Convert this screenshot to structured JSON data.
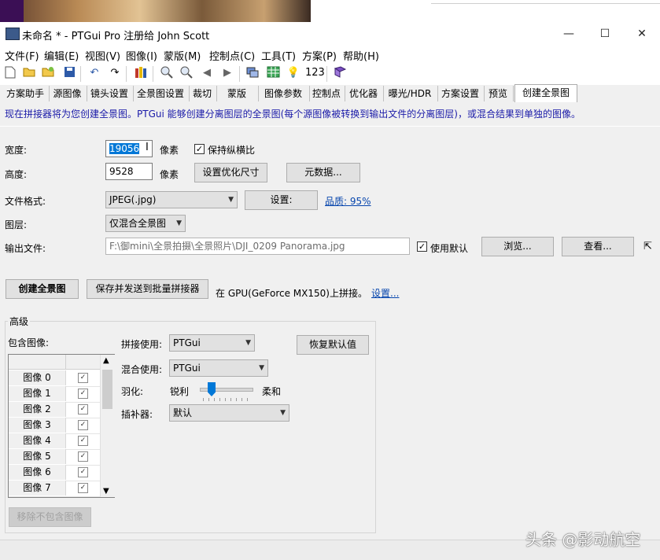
{
  "window": {
    "title": "未命名 * - PTGui Pro 注册给 John Scott",
    "minimize": "—",
    "maximize": "☐",
    "close": "✕"
  },
  "menu": [
    "文件(F)",
    "编辑(E)",
    "视图(V)",
    "图像(I)",
    "蒙版(M)",
    "控制点(C)",
    "工具(T)",
    "方案(P)",
    "帮助(H)"
  ],
  "toolbar": {
    "zoom_readout": "123"
  },
  "tabs": [
    "方案助手",
    "源图像",
    "镜头设置",
    "全景图设置",
    "裁切",
    "蒙版",
    "图像参数",
    "控制点",
    "优化器",
    "曝光/HDR",
    "方案设置",
    "预览",
    "创建全景图"
  ],
  "active_tab": "创建全景图",
  "info": "现在拼接器将为您创建全景图。PTGui 能够创建分离图层的全景图(每个源图像被转换到输出文件的分离图层)，或混合结果到单独的图像。",
  "form": {
    "width_label": "宽度:",
    "width_value": "19056",
    "pixel_unit_1": "像素",
    "keep_ratio": "保持纵横比",
    "height_label": "高度:",
    "height_value": "9528",
    "pixel_unit_2": "像素",
    "optimize_size_btn": "设置优化尺寸",
    "metadata_btn": "元数据...",
    "format_label": "文件格式:",
    "format_value": "JPEG(.jpg)",
    "settings_btn": "设置:",
    "quality_link": "品质: 95%",
    "layer_label": "图层:",
    "layer_value": "仅混合全景图",
    "output_label": "输出文件:",
    "output_value": "F:\\御mini\\全景拍摄\\全景照片\\DJI_0209 Panorama.jpg",
    "use_default": "使用默认",
    "browse_btn": "浏览...",
    "view_btn": "查看..."
  },
  "actions": {
    "create_btn": "创建全景图",
    "batch_btn": "保存并发送到批量拼接器",
    "gpu_text": "在 GPU(GeForce MX150)上拼接。",
    "gpu_settings_link": "设置..."
  },
  "advanced": {
    "group_title": "高级",
    "include_label": "包含图像:",
    "images": [
      "图像 0",
      "图像 1",
      "图像 2",
      "图像 3",
      "图像 4",
      "图像 5",
      "图像 6",
      "图像 7"
    ],
    "remove_btn": "移除不包含图像",
    "stitch_label": "拼接使用:",
    "stitch_value": "PTGui",
    "blend_label": "混合使用:",
    "blend_value": "PTGui",
    "feather_label": "羽化:",
    "feather_min": "锐利",
    "feather_max": "柔和",
    "feather_level": 0.25,
    "interp_label": "插补器:",
    "interp_value": "默认",
    "restore_btn": "恢复默认值"
  },
  "watermark": "头条 @影动航空",
  "colors": {
    "info_text": "#1a1aa8",
    "link": "#0645ad",
    "slider": "#0078d7"
  }
}
